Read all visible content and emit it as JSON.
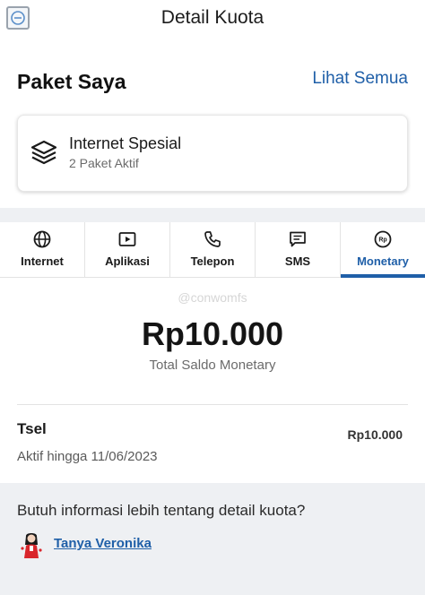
{
  "header": {
    "title": "Detail Kuota",
    "back_icon": "back-icon"
  },
  "paket": {
    "title": "Paket Saya",
    "see_all": "Lihat Semua"
  },
  "card": {
    "icon": "layers-icon",
    "title": "Internet Spesial",
    "subtitle": "2 Paket Aktif"
  },
  "tabs": [
    {
      "label": "Internet",
      "icon": "globe-icon",
      "active": false
    },
    {
      "label": "Aplikasi",
      "icon": "play-icon",
      "active": false
    },
    {
      "label": "Telepon",
      "icon": "phone-icon",
      "active": false
    },
    {
      "label": "SMS",
      "icon": "message-icon",
      "active": false
    },
    {
      "label": "Monetary",
      "icon": "rupiah-icon",
      "active": true
    }
  ],
  "monetary": {
    "watermark": "@conwomfs",
    "amount": "Rp10.000",
    "caption": "Total Saldo Monetary"
  },
  "item": {
    "name": "Tsel",
    "value": "Rp10.000",
    "validity": "Aktif hingga 11/06/2023"
  },
  "info": {
    "question": "Butuh informasi lebih tentang detail kuota?",
    "link": "Tanya Veronika"
  },
  "colors": {
    "accent": "#1f5fa8",
    "band": "#eef0f3"
  }
}
